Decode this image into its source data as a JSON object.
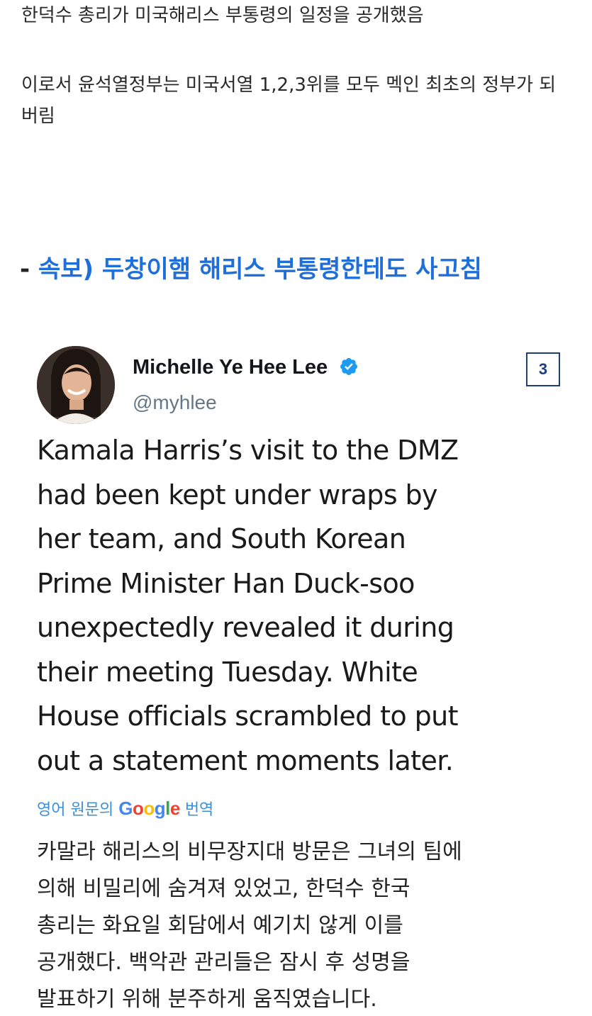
{
  "post": {
    "intro_line1": "한덕수 총리가 미국해리스 부통령의 일정을 공개했음",
    "intro_line2": "이로서 윤석열정부는 미국서열 1,2,3위를 모두 멕인 최초의 정부가 되버림",
    "headline_dash": "-",
    "headline": "속보) 두창이햄 해리스 부통령한테도 사고침"
  },
  "tweet": {
    "author_name": "Michelle Ye Hee Lee",
    "handle": "@myhlee",
    "badge": "3",
    "body_lines": [
      "Kamala Harris’s visit to the DMZ",
      "had been kept under wraps by",
      "her team, and South Korean",
      "Prime Minister Han Duck-soo",
      "unexpectedly revealed it during",
      "their meeting Tuesday. White",
      "House officials scrambled to put",
      "out a statement moments later."
    ],
    "translate_prefix": "영어 원문의",
    "translate_brand": "Google",
    "translate_suffix": "번역",
    "translation_lines": [
      "카말라 해리스의 비무장지대 방문은 그녀의 팀에",
      "의해 비밀리에 숨겨져 있었고, 한덕수 한국",
      "총리는 화요일 회담에서 예기치 않게 이를",
      "공개했다. 백악관 관리들은 잠시 후 성명을",
      "발표하기 위해 분주하게 움직였습니다."
    ]
  },
  "colors": {
    "headline": "#1e6fd9",
    "verified": "#1d9bf0",
    "badge": "#1f3d7a",
    "translate": "#3b8fd9"
  }
}
